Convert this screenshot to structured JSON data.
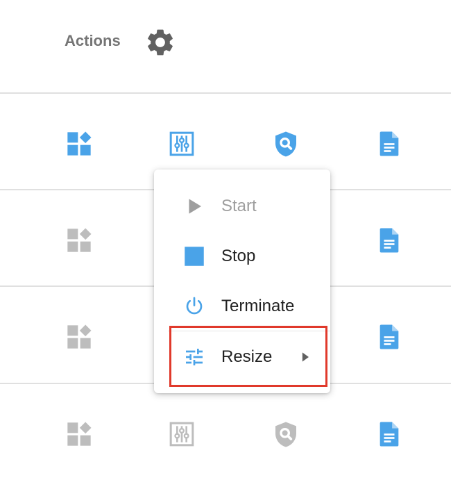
{
  "header": {
    "actions_label": "Actions",
    "gear_icon": "gear-icon"
  },
  "rows": [
    {
      "icons": [
        "apps-icon",
        "sliders-icon",
        "shield-search-icon",
        "document-icon"
      ],
      "active": [
        true,
        true,
        true,
        true
      ]
    },
    {
      "icons": [
        "apps-icon",
        "sliders-icon",
        "shield-search-icon",
        "document-icon"
      ],
      "active": [
        false,
        false,
        false,
        true
      ]
    },
    {
      "icons": [
        "apps-icon",
        "sliders-icon",
        "shield-search-icon",
        "document-icon"
      ],
      "active": [
        false,
        false,
        false,
        true
      ]
    },
    {
      "icons": [
        "apps-icon",
        "sliders-icon",
        "shield-search-icon",
        "document-icon"
      ],
      "active": [
        false,
        false,
        false,
        true
      ]
    }
  ],
  "menu": {
    "items": [
      {
        "label": "Start",
        "icon": "play-icon",
        "disabled": true
      },
      {
        "label": "Stop",
        "icon": "stop-icon",
        "disabled": false
      },
      {
        "label": "Terminate",
        "icon": "power-icon",
        "disabled": false
      },
      {
        "label": "Resize",
        "icon": "tune-icon",
        "disabled": false,
        "submenu": true
      }
    ]
  },
  "colors": {
    "accent": "#4aa3e8",
    "inactive": "#bdbdbd",
    "header_text": "#757575",
    "gear": "#616161",
    "highlight": "#e0392b"
  }
}
